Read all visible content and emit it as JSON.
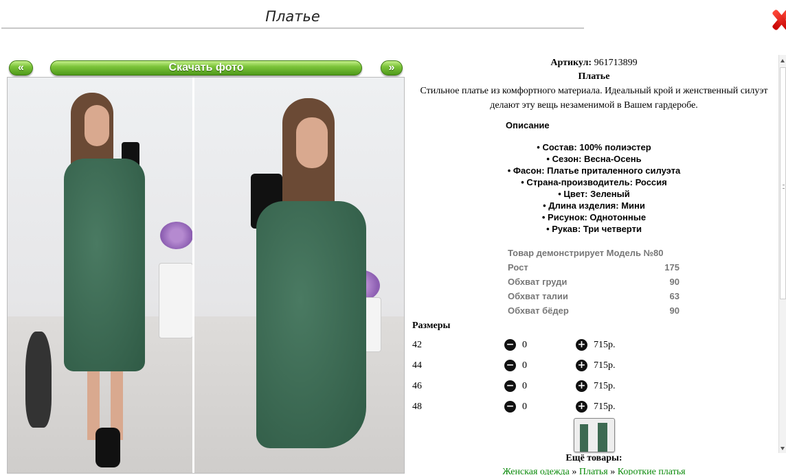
{
  "window": {
    "title": "Платье"
  },
  "nav": {
    "prev_label": "«",
    "download_label": "Скачать фото",
    "next_label": "»"
  },
  "product": {
    "article_label": "Артикул:",
    "article_value": "961713899",
    "name": "Платье",
    "description": "Стильное платье из комфортного материала. Идеальный крой и женственный силуэт делают эту вещь незаменимой в Вашем гардеробе."
  },
  "specs": {
    "heading": "Описание",
    "items": [
      "• Состав: 100% полиэстер",
      "• Сезон: Весна-Осень",
      "• Фасон: Платье приталенного силуэта",
      "• Страна-производитель: Россия",
      "• Цвет: Зеленый",
      "• Длина изделия: Мини",
      "• Рисунок: Однотонные",
      "• Рукав: Три четверти"
    ]
  },
  "model": {
    "title": "Товар демонстрирует Модель №80",
    "rows": [
      {
        "label": "Рост",
        "value": "175"
      },
      {
        "label": "Обхват груди",
        "value": "90"
      },
      {
        "label": "Обхват талии",
        "value": "63"
      },
      {
        "label": "Обхват бёдер",
        "value": "90"
      }
    ]
  },
  "sizes": {
    "heading": "Размеры",
    "rows": [
      {
        "size": "42",
        "qty": "0",
        "price": "715р."
      },
      {
        "size": "44",
        "qty": "0",
        "price": "715р."
      },
      {
        "size": "46",
        "qty": "0",
        "price": "715р."
      },
      {
        "size": "48",
        "qty": "0",
        "price": "715р."
      }
    ]
  },
  "more": {
    "heading": "Ещё товары:",
    "crumbs": [
      "Женская одежда",
      "Платья",
      "Короткие платья"
    ],
    "separator": "»"
  },
  "icons": {
    "close": "close-x-icon",
    "minus": "minus-circle-icon",
    "plus": "plus-circle-icon"
  },
  "colors": {
    "button_green": "#6cb52c",
    "link_green": "#0a8a0a",
    "close_red": "#d40000"
  }
}
